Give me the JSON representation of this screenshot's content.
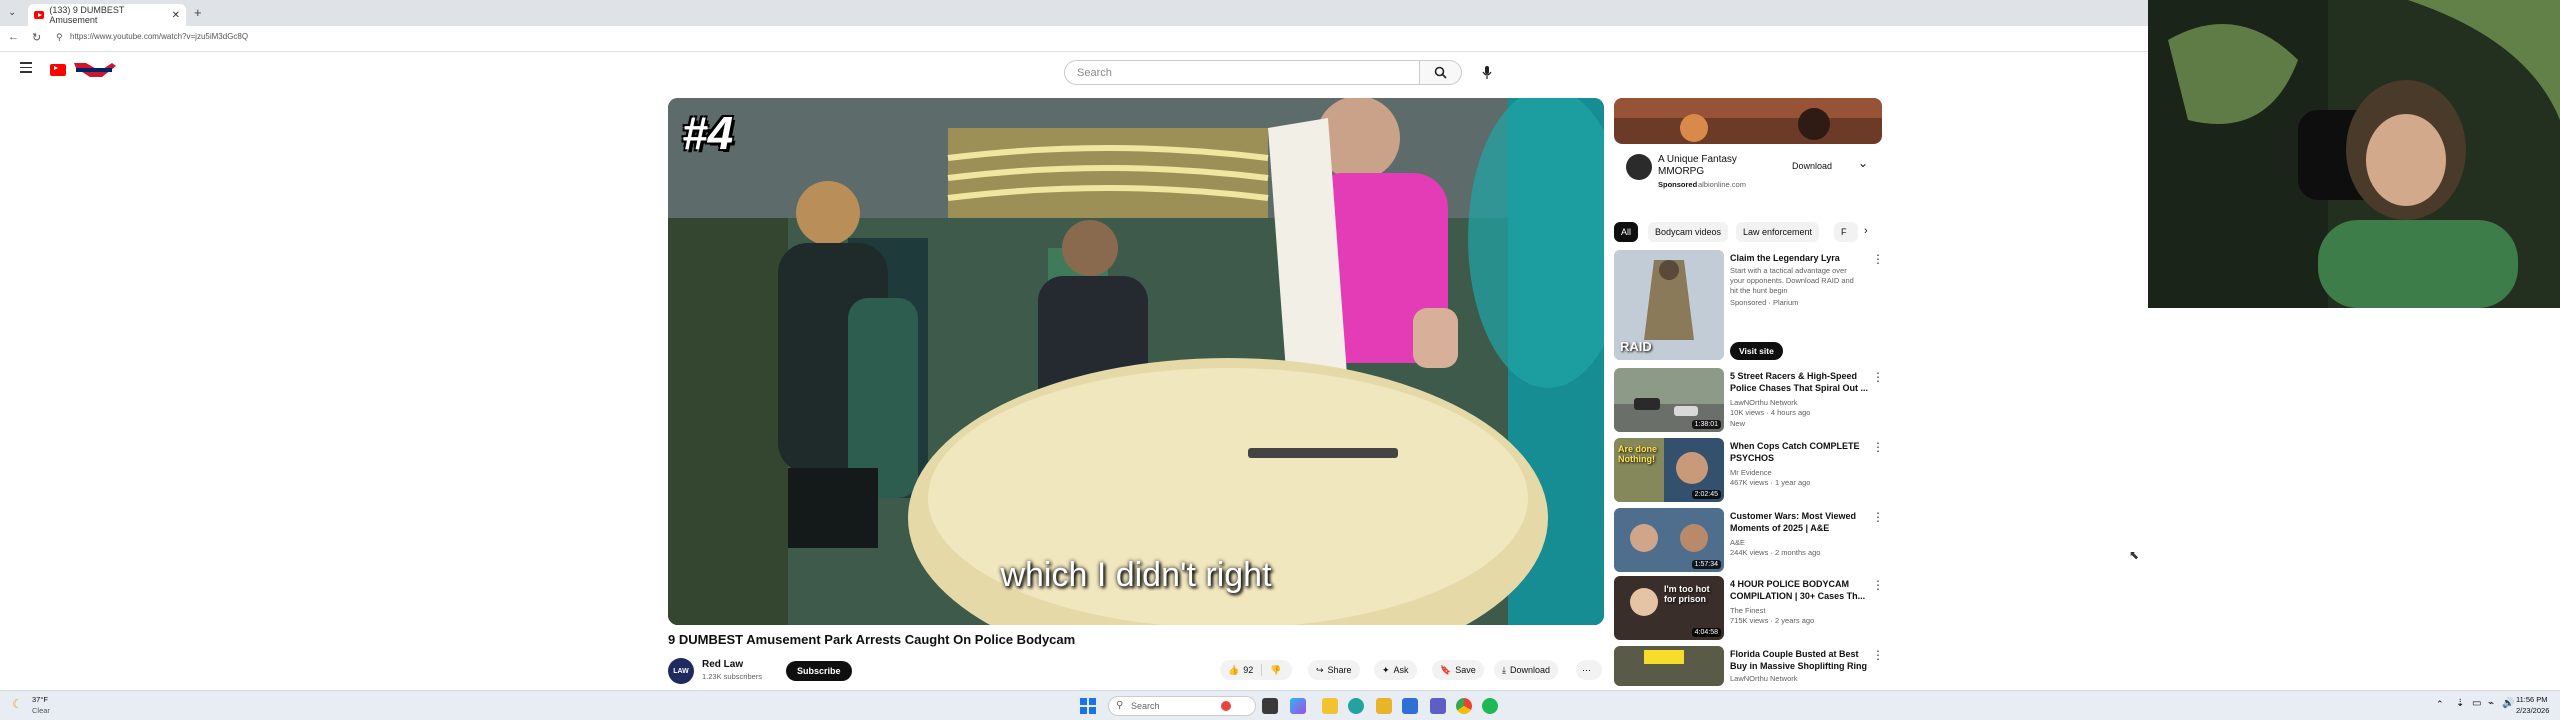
{
  "browser": {
    "tab_title": "(133) 9 DUMBEST Amusement",
    "url": "https://www.youtube.com/watch?v=jzu5iM3dGc8Q"
  },
  "youtube": {
    "search_placeholder": "Search"
  },
  "video": {
    "rank_overlay": "#4",
    "caption": "which I didn't right",
    "title": "9 DUMBEST Amusement Park Arrests Caught On Police Bodycam",
    "channel": "Red Law",
    "subscribers": "1.23K subscribers",
    "subscribe_label": "Subscribe",
    "like_count": "92",
    "share_label": "Share",
    "ask_label": "Ask",
    "save_label": "Save",
    "download_label": "Download",
    "channel_avatar_text": "LAW"
  },
  "ad": {
    "title_line1": "A Unique Fantasy",
    "title_line2": "MMORPG",
    "sponsored": "Sponsored",
    "domain": "albionline.com",
    "download_label": "Download"
  },
  "chips": [
    "All",
    "Bodycam videos",
    "Law enforcement",
    "F"
  ],
  "recommendations": [
    {
      "title": "Claim the Legendary Lyra",
      "meta1": "Start with a tactical advantage over",
      "meta2": "your opponents. Download RAID and",
      "meta3": "hit the hunt begin",
      "meta4": "Sponsored · Plarium",
      "cta": "Visit site",
      "thumb_text": "RAID"
    },
    {
      "title": "5 Street Racers & High-Speed Police Chases That Spiral Out ...",
      "channel": "LawNOrthu Network",
      "views": "10K views · 4 hours ago",
      "badge": "New",
      "duration": "1:38:01"
    },
    {
      "title": "When Cops Catch COMPLETE PSYCHOS",
      "channel": "Mr Evidence",
      "views": "467K views · 1 year ago",
      "duration": "2:02:45",
      "thumb_text": "Are done Nothing!"
    },
    {
      "title": "Customer Wars: Most Viewed Moments of 2025 | A&E",
      "channel": "A&E",
      "views": "244K views · 2 months ago",
      "duration": "1:57:34"
    },
    {
      "title": "4 HOUR POLICE BODYCAM COMPILATION | 30+ Cases Th...",
      "channel": "The Finest",
      "views": "715K views · 2 years ago",
      "duration": "4:04:58",
      "thumb_text": "I'm too hot for prison"
    },
    {
      "title": "Florida Couple Busted at Best Buy in Massive Shoplifting Ring",
      "channel": "LawNOrthu Network"
    }
  ],
  "taskbar": {
    "weather_temp": "37°F",
    "weather_desc": "Clear",
    "search_label": "Search",
    "time": "11:56 PM",
    "date": "2/23/2026"
  },
  "colors": {
    "yt_red": "#ff0000",
    "pink_shirt": "#e43bb6",
    "win_blue": "#1a73e8"
  }
}
